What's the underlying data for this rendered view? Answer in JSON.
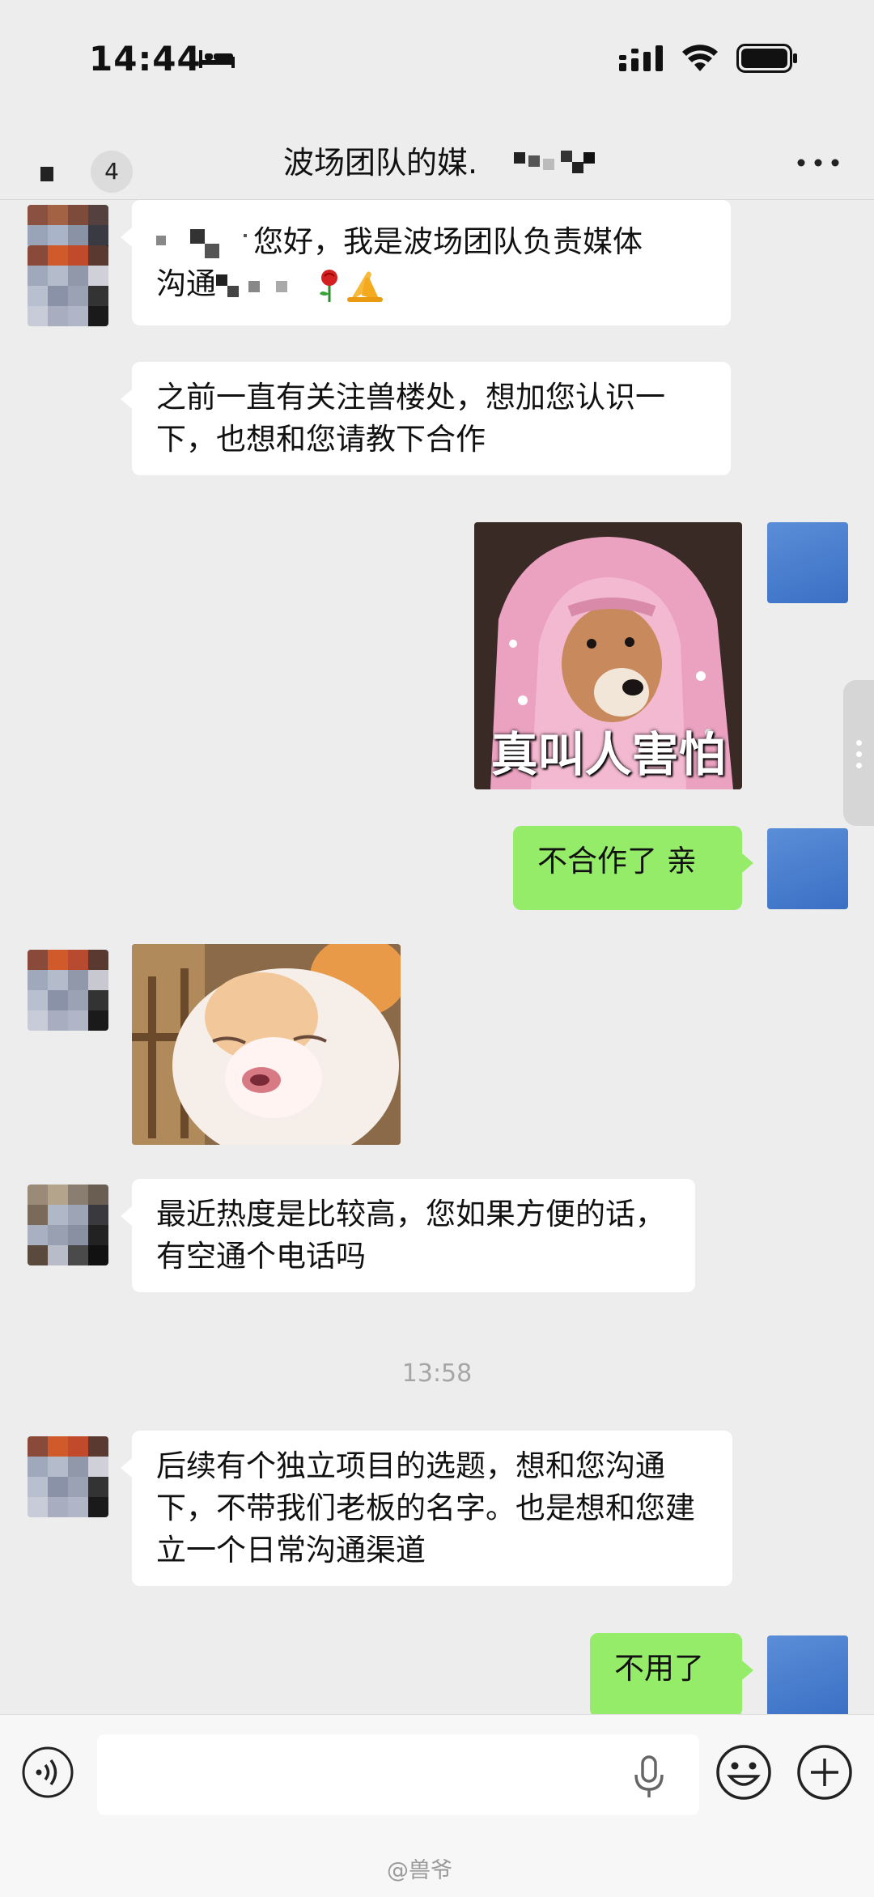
{
  "status_bar": {
    "time": "14:44",
    "icons": [
      "bed-icon",
      "signal-icon",
      "wifi-icon",
      "battery-icon"
    ]
  },
  "header": {
    "unread_count": "4",
    "title": "波场团队的媒.",
    "icons": [
      "back-icon",
      "more-icon"
    ]
  },
  "messages": [
    {
      "side": "left",
      "type": "text",
      "text": "您好，我是波场团队负责媒体",
      "text_line2": "沟通"
    },
    {
      "side": "left",
      "type": "text",
      "text": "之前一直有关注兽楼处，想加您认识一下，也想和您请教下合作"
    },
    {
      "side": "right",
      "type": "sticker",
      "caption": "真叫人害怕"
    },
    {
      "side": "right",
      "type": "text",
      "text": "不合作了 亲"
    },
    {
      "side": "left",
      "type": "sticker",
      "caption": ""
    },
    {
      "side": "left",
      "type": "text",
      "text": "最近热度是比较高，您如果方便的话，有空通个电话吗"
    },
    {
      "type": "timestamp",
      "text": "13:58"
    },
    {
      "side": "left",
      "type": "text",
      "text": "后续有个独立项目的选题，想和您沟通下，不带我们老板的名字。也是想和您建立一个日常沟通渠道"
    },
    {
      "side": "right",
      "type": "text",
      "text": "不用了"
    }
  ],
  "input_bar": {
    "placeholder": "",
    "icons": [
      "voice-icon",
      "mic-icon",
      "emoji-icon",
      "plus-icon"
    ]
  },
  "watermark": "@兽爷",
  "colors": {
    "background": "#ededed",
    "bubble_self": "#95ec69",
    "bubble_other": "#ffffff"
  }
}
